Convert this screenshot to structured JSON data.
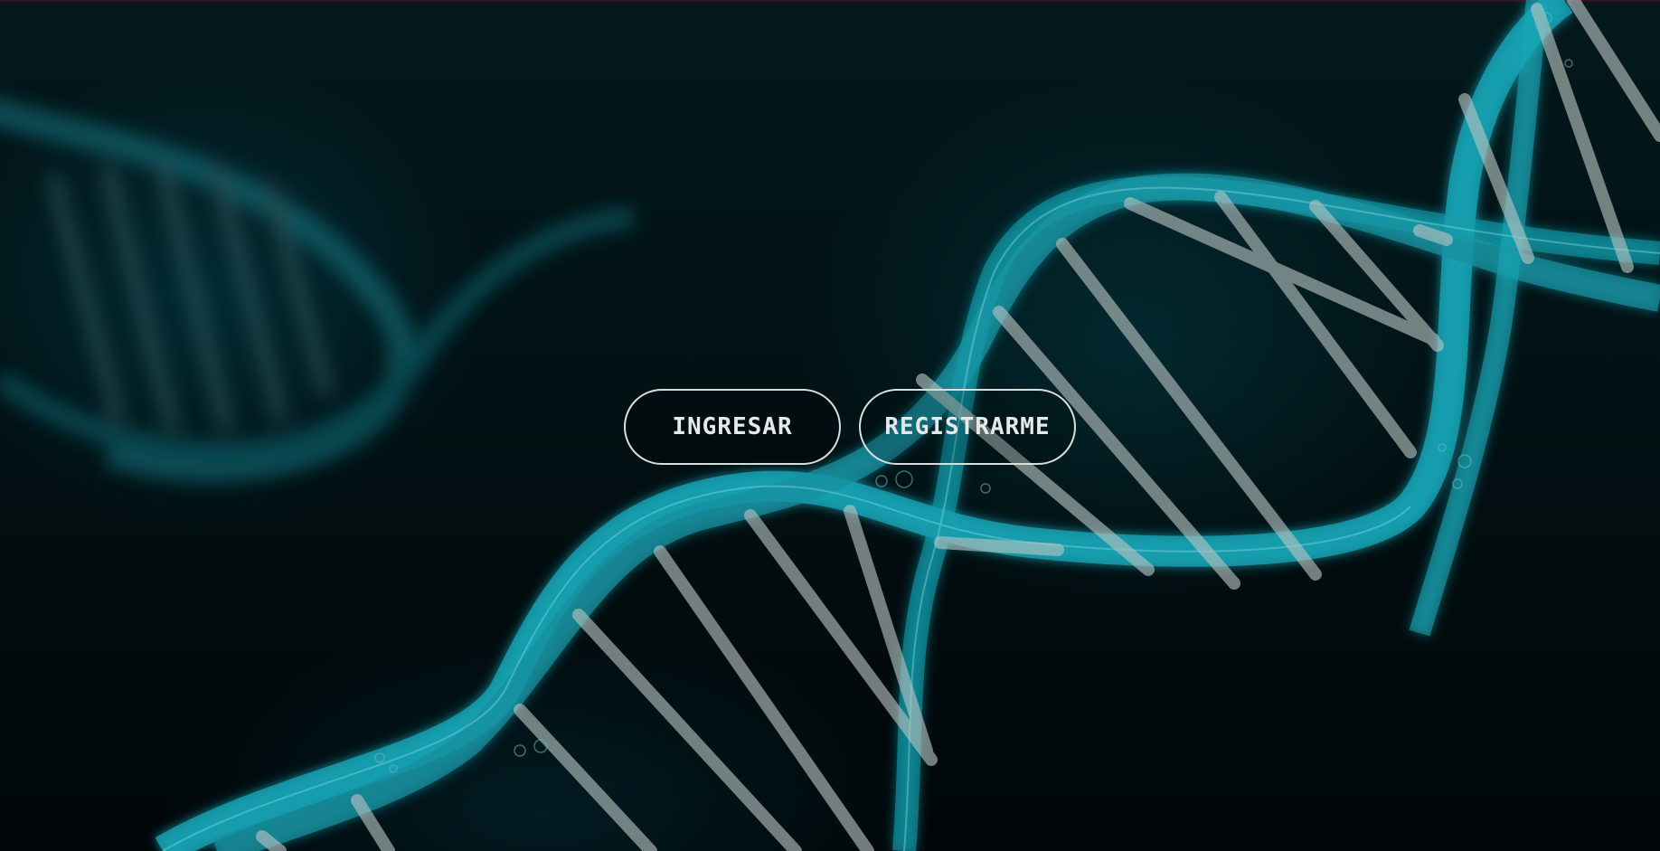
{
  "background": {
    "theme": "dna-helix",
    "colors": {
      "base": "#020a0c",
      "helix": "#1aa7b8",
      "rungs": "#b9c4c2"
    }
  },
  "actions": {
    "login_label": "INGRESAR",
    "register_label": "REGISTRARME"
  }
}
